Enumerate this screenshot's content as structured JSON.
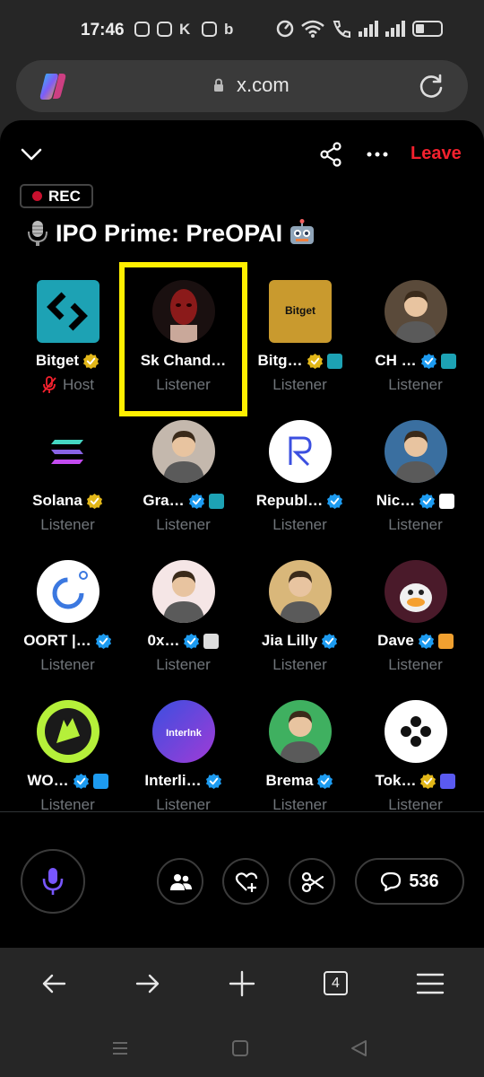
{
  "status_bar": {
    "time": "17:46"
  },
  "browser": {
    "domain": "x.com",
    "tab_count": "4"
  },
  "space": {
    "leave_label": "Leave",
    "rec_label": "REC",
    "title": "IPO Prime: PreOPAI",
    "participants": [
      {
        "name": "Bitget",
        "role": "Host",
        "avatar_color": "#1da2b4"
      },
      {
        "name": "Sk Chand…",
        "role": "Listener",
        "avatar_color": "#8b1a1a"
      },
      {
        "name": "Bitg…",
        "role": "Listener",
        "avatar_color": "#c99a2e"
      },
      {
        "name": "CH …",
        "role": "Listener",
        "avatar_color": "#5a4a3a"
      },
      {
        "name": "Solana",
        "role": "Listener",
        "avatar_color": "#000000"
      },
      {
        "name": "Gra…",
        "role": "Listener",
        "avatar_color": "#c4b8ad"
      },
      {
        "name": "Republ…",
        "role": "Listener",
        "avatar_color": "#ffffff"
      },
      {
        "name": "Nic…",
        "role": "Listener",
        "avatar_color": "#3a6fa0"
      },
      {
        "name": "OORT |…",
        "role": "Listener",
        "avatar_color": "#ffffff"
      },
      {
        "name": "0x…",
        "role": "Listener",
        "avatar_color": "#f5e6e6"
      },
      {
        "name": "Jia Lilly",
        "role": "Listener",
        "avatar_color": "#d9b77a"
      },
      {
        "name": "Dave",
        "role": "Listener",
        "avatar_color": "#4a1a2a"
      },
      {
        "name": "WO…",
        "role": "Listener",
        "avatar_color": "#1a1a1a"
      },
      {
        "name": "Interli…",
        "role": "Listener",
        "avatar_color": "#5a3fd0"
      },
      {
        "name": "Brema",
        "role": "Listener",
        "avatar_color": "#3fb060"
      },
      {
        "name": "Tok…",
        "role": "Listener",
        "avatar_color": "#ffffff"
      }
    ],
    "comment_count": "536"
  },
  "colors": {
    "leave": "#f4212e",
    "verified_blue": "#1d9bf0",
    "verified_gold": "#e2b719",
    "mic": "#7856ff",
    "highlight": "#ffef00"
  },
  "icons": [
    "chevron-down-icon",
    "share-icon",
    "more-icon",
    "mic-icon",
    "people-icon",
    "heart-plus-icon",
    "scissors-icon",
    "comment-icon"
  ]
}
